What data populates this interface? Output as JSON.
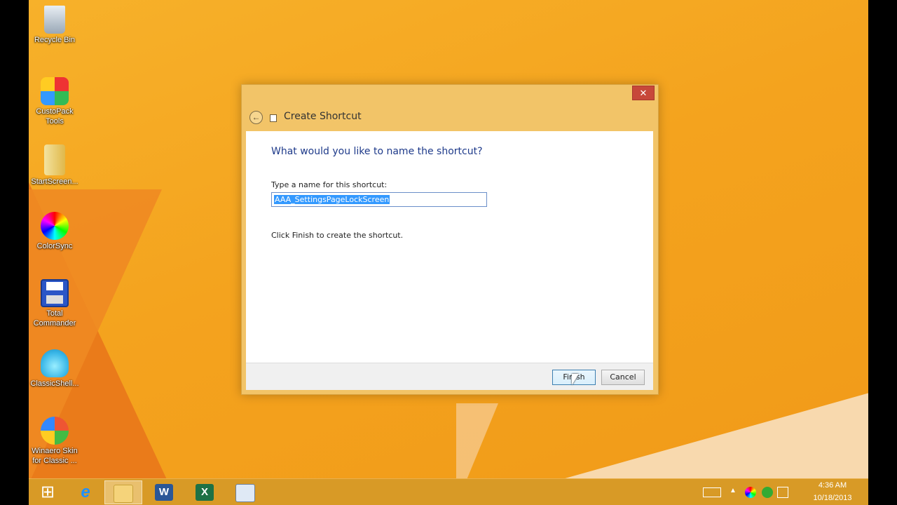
{
  "desktop": {
    "icons": [
      {
        "label": "Recycle Bin",
        "icon": "recycle-bin-icon"
      },
      {
        "label": "CustoPack Tools",
        "icon": "custopack-icon"
      },
      {
        "label": "StartScreen...",
        "icon": "startscreen-icon"
      },
      {
        "label": "ColorSync",
        "icon": "colorsync-icon"
      },
      {
        "label": "Total Commander",
        "icon": "floppy-disk-icon"
      },
      {
        "label": "ClassicShell...",
        "icon": "shell-icon"
      },
      {
        "label": "Winaero Skin for Classic ...",
        "icon": "winaero-icon"
      }
    ]
  },
  "dialog": {
    "title": "Create Shortcut",
    "close_label": "✕",
    "back_label": "←",
    "heading": "What would you like to name the shortcut?",
    "field_label": "Type a name for this shortcut:",
    "field_value": "AAA_SettingsPageLockScreen",
    "instruction": "Click Finish to create the shortcut.",
    "finish_label": "Finish",
    "cancel_label": "Cancel"
  },
  "taskbar": {
    "apps": [
      {
        "name": "start",
        "glyph": "⊞"
      },
      {
        "name": "internet-explorer",
        "glyph": "e"
      },
      {
        "name": "file-explorer",
        "glyph": ""
      },
      {
        "name": "word",
        "glyph": "W"
      },
      {
        "name": "excel",
        "glyph": "X"
      },
      {
        "name": "paint",
        "glyph": ""
      }
    ],
    "clock_time": "4:36 AM",
    "clock_date": "10/18/2013"
  },
  "colors": {
    "accent": "#f2c468",
    "heading": "#1e3a8a",
    "close": "#c7483a"
  }
}
